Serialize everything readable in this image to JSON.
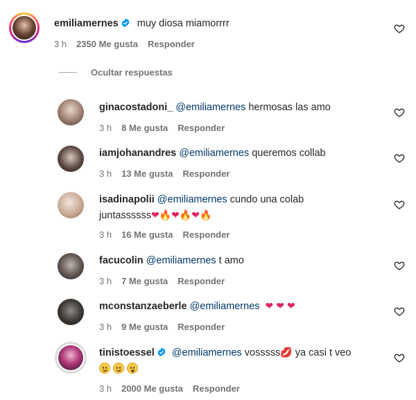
{
  "main_comment": {
    "username": "emiliamernes",
    "text": "muy diosa miamorrrr",
    "time": "3 h",
    "likes": "2350 Me gusta",
    "reply": "Responder"
  },
  "hide_replies_label": "Ocultar respuestas",
  "replies": [
    {
      "username": "ginacostadoni_",
      "mention": "@emiliamernes",
      "text": " hermosas las amo",
      "time": "3 h",
      "likes": "8 Me gusta",
      "reply": "Responder"
    },
    {
      "username": "iamjohanandres",
      "mention": "@emiliamernes",
      "text": " queremos collab",
      "time": "3 h",
      "likes": "13 Me gusta",
      "reply": "Responder"
    },
    {
      "username": "isadinapolii",
      "mention": "@emiliamernes",
      "text": " cundo una colab",
      "text2": "juntassssss",
      "time": "3 h",
      "likes": "16 Me gusta",
      "reply": "Responder"
    },
    {
      "username": "facucolin",
      "mention": "@emiliamernes",
      "text": " t amo",
      "time": "3 h",
      "likes": "7 Me gusta",
      "reply": "Responder"
    },
    {
      "username": "mconstanzaeberle",
      "mention": "@emiliamernes",
      "text": "",
      "time": "3 h",
      "likes": "9 Me gusta",
      "reply": "Responder"
    },
    {
      "username": "tinistoessel",
      "mention": "@emiliamernes",
      "text": " vosssss",
      "text_after": "ya casi t veo",
      "time": "3 h",
      "likes": "2000 Me gusta",
      "reply": "Responder"
    }
  ],
  "colors": {
    "mention": "#00376b",
    "meta": "#737373",
    "verified": "#0095f6",
    "heart_emoji": "#e0245e"
  },
  "icons": {
    "like": "heart-outline-icon",
    "verified": "verified-badge-icon"
  }
}
